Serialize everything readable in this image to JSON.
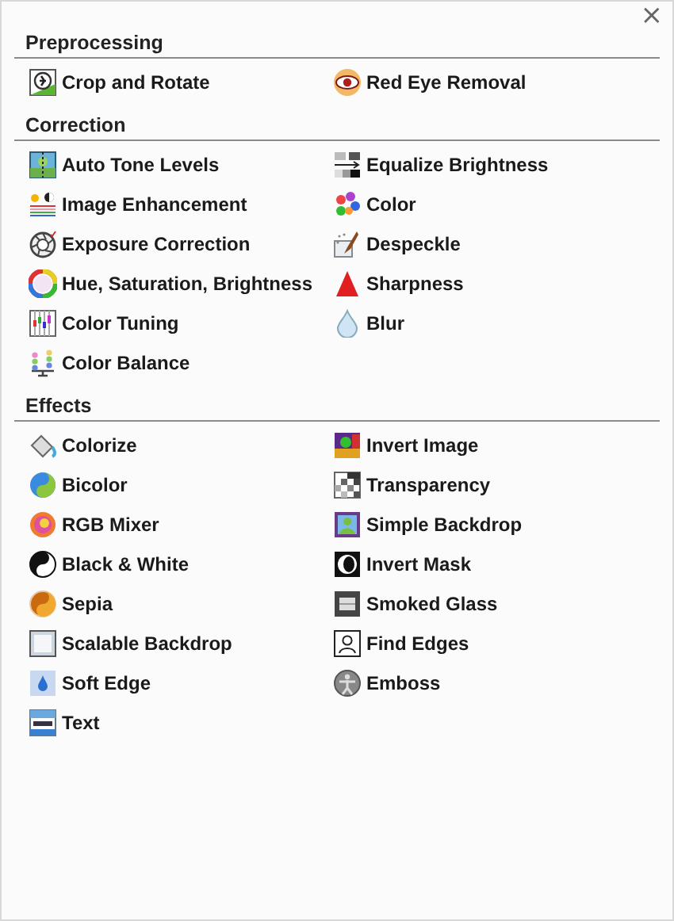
{
  "close_button": {
    "label": "×"
  },
  "sections": [
    {
      "title": "Preprocessing",
      "left_column": [
        "Crop and Rotate"
      ],
      "right_column": [
        "Red Eye Removal"
      ]
    },
    {
      "title": "Correction",
      "left_column": [
        "Auto Tone Levels",
        "Image Enhancement",
        "Exposure Correction",
        "Hue, Saturation, Brightness",
        "Color Tuning",
        "Color Balance"
      ],
      "right_column": [
        "Equalize Brightness",
        "Color",
        "Despeckle",
        "Sharpness",
        "Blur"
      ]
    },
    {
      "title": "Effects",
      "left_column": [
        "Colorize",
        "Bicolor",
        "RGB Mixer",
        "Black & White",
        "Sepia",
        "Scalable Backdrop",
        "Soft Edge",
        "Text"
      ],
      "right_column": [
        "Invert Image",
        "Transparency",
        "Simple Backdrop",
        "Invert Mask",
        "Smoked Glass",
        "Find Edges",
        "Emboss"
      ]
    }
  ]
}
